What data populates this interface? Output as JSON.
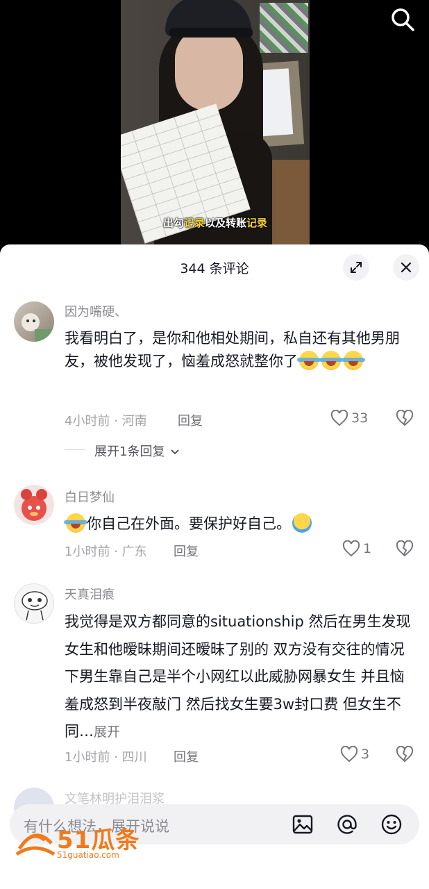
{
  "video": {
    "subtitle_prefix": "出勾",
    "subtitle_hl1": "记录",
    "subtitle_mid": "以及转账",
    "subtitle_hl2": "记录",
    "search_icon": "search-icon"
  },
  "panel": {
    "count_title": "344 条评论",
    "expand_icon": "expand-icon",
    "close_icon": "close-icon"
  },
  "comments": [
    {
      "username": "因为嘴硬、",
      "text": "我看明白了，是你和他相处期间，私自还有其他男朋友，被他发现了，恼羞成怒就整你了",
      "time_location": "4小时前 · 河南",
      "reply_label": "回复",
      "likes": "33",
      "expand_replies": "展开1条回复"
    },
    {
      "username": "白日梦仙",
      "text": "你自己在外面。要保护好自己。",
      "time_location": "1小时前 · 广东",
      "reply_label": "回复",
      "likes": "1"
    },
    {
      "username": "天真泪痕",
      "text": "我觉得是双方都同意的situationship 然后在男生发现女生和他暧昧期间还暧昧了别的 双方没有交往的情况下男生靠自己是半个小网红以此威胁网暴女生 并且恼羞成怒到半夜敲门 然后找女生要3w封口费 但女生不同…",
      "expand_label": "展开",
      "time_location": "1小时前 · 四川",
      "reply_label": "回复",
      "likes": "3"
    },
    {
      "username": "文笔林明护泪泪浆"
    }
  ],
  "input": {
    "placeholder": "有什么想法，展开说说",
    "image_icon": "image-icon",
    "mention_icon": "at-icon",
    "emoji_icon": "emoji-icon"
  },
  "watermark": {
    "brand": "51瓜条",
    "url": "51guatiao.com"
  },
  "colors": {
    "accent_orange": "#f07a1c",
    "text_primary": "#161823",
    "text_secondary": "#8a8b91"
  }
}
